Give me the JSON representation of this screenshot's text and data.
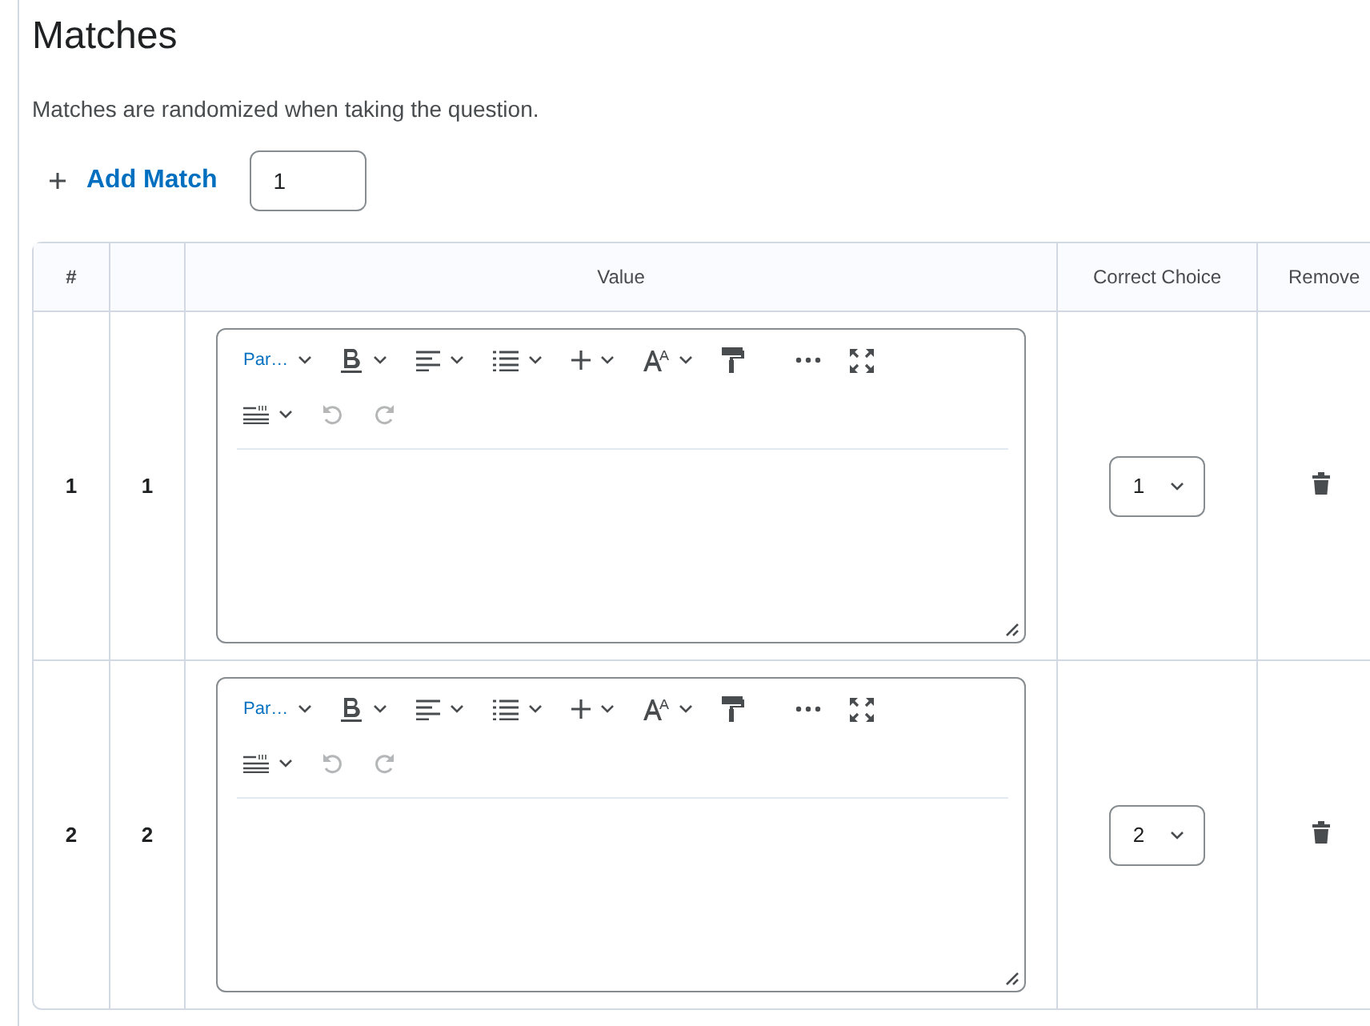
{
  "section": {
    "title": "Matches",
    "description": "Matches are randomized when taking the question."
  },
  "add_match": {
    "label": "Add Match",
    "count": "1"
  },
  "table": {
    "columns": {
      "number": "#",
      "value": "Value",
      "correct_choice": "Correct Choice",
      "remove": "Remove"
    },
    "rows": [
      {
        "number": "1",
        "match": "1",
        "format_label": "Par…",
        "correct_choice": "1"
      },
      {
        "number": "2",
        "match": "2",
        "format_label": "Par…",
        "correct_choice": "2"
      }
    ]
  },
  "editor_toolbar": [
    {
      "kind": "format",
      "disabled": false
    },
    {
      "kind": "bold",
      "disabled": false
    },
    {
      "kind": "align",
      "disabled": false
    },
    {
      "kind": "list",
      "disabled": false
    },
    {
      "kind": "insert",
      "disabled": false
    },
    {
      "kind": "font-size",
      "disabled": false
    },
    {
      "kind": "paint",
      "disabled": false
    },
    {
      "kind": "more",
      "disabled": false
    },
    {
      "kind": "fullscreen",
      "disabled": false
    },
    {
      "kind": "line-spacing",
      "disabled": false
    },
    {
      "kind": "undo",
      "disabled": true
    },
    {
      "kind": "redo",
      "disabled": true
    }
  ]
}
